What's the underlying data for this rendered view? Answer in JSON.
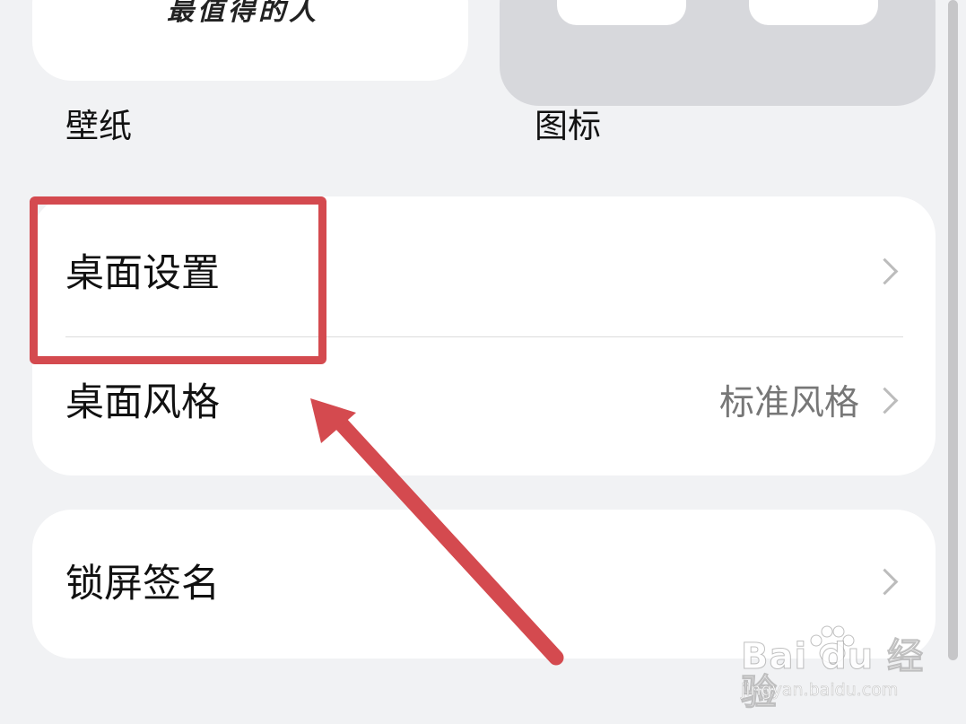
{
  "wallpaper_card": {
    "preview_text": "最值得的人"
  },
  "labels": {
    "wallpaper": "壁纸",
    "icons": "图标"
  },
  "settings_group_1": {
    "desktop_settings": {
      "label": "桌面设置",
      "icon": "chevron-right-icon"
    },
    "desktop_style": {
      "label": "桌面风格",
      "value": "标准风格",
      "icon": "chevron-right-icon"
    }
  },
  "settings_group_2": {
    "lock_screen_signature": {
      "label": "锁屏签名",
      "icon": "chevron-right-icon"
    }
  },
  "annotation": {
    "color": "#d44a4f"
  },
  "watermark": {
    "brand": "Bai du 经验",
    "url": "jingyan.baidu.com"
  }
}
